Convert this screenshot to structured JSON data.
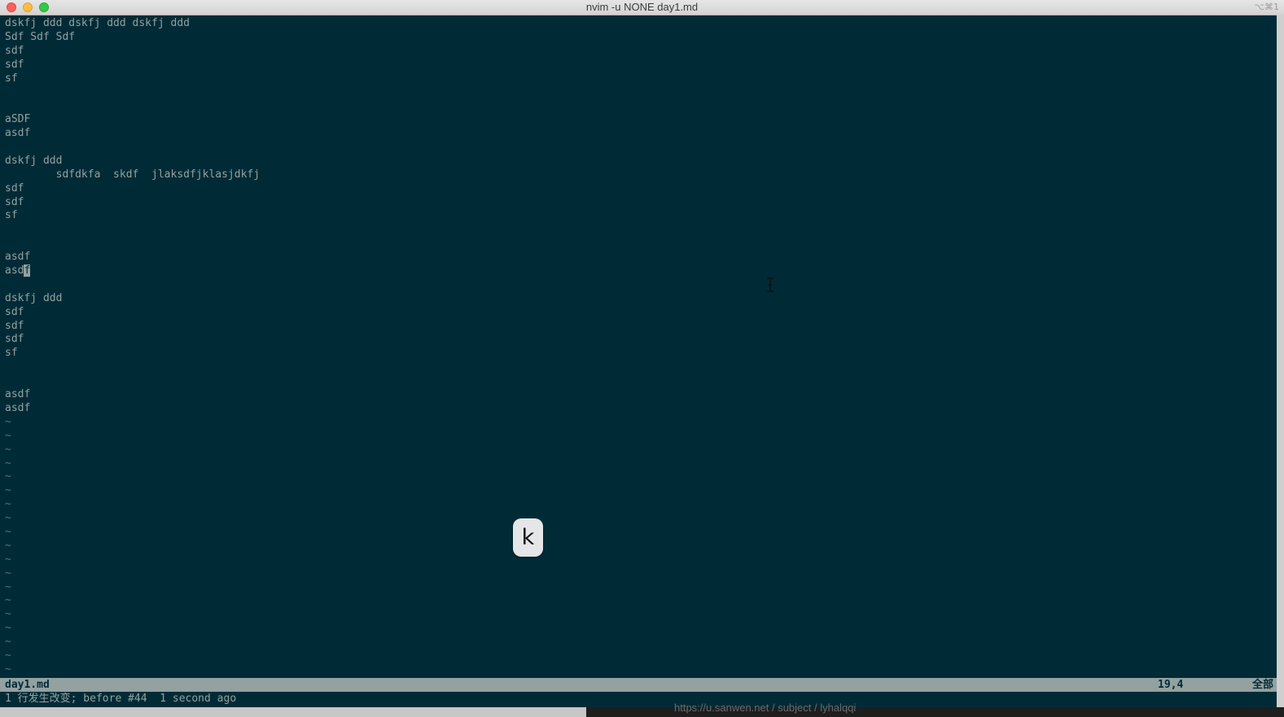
{
  "window": {
    "title": "nvim -u NONE day1.md",
    "shortcut": "⌥⌘1"
  },
  "editor": {
    "lines_before_cursor": [
      "dskfj ddd dskfj ddd dskfj ddd",
      "Sdf Sdf Sdf",
      "sdf",
      "sdf",
      "sf",
      "",
      "",
      "aSDF",
      "asdf",
      "",
      "dskfj ddd",
      "        sdfdkfa  skdf  jlaksdfjklasjdkfj",
      "sdf",
      "sdf",
      "sf",
      "",
      "",
      "asdf"
    ],
    "cursor_line_prefix": "asd",
    "cursor_char": "f",
    "lines_after_cursor": [
      "",
      "dskfj ddd",
      "sdf",
      "sdf",
      "sdf",
      "sf",
      "",
      "",
      "asdf",
      "asdf"
    ],
    "tilde_count": 19,
    "tilde_char": "~"
  },
  "statusline": {
    "filename": "day1.md",
    "position": "19,4",
    "scroll": "全部"
  },
  "cmdline": {
    "message": "1 行发生改变; before #44  1 second ago"
  },
  "overlay": {
    "key_pressed": "k",
    "bottom_url": "https://u.sanwen.net / subject / lyhalqqi"
  },
  "colors": {
    "background": "#002b36",
    "foreground": "#93a1a1",
    "statusline_bg": "#93a1a1"
  }
}
